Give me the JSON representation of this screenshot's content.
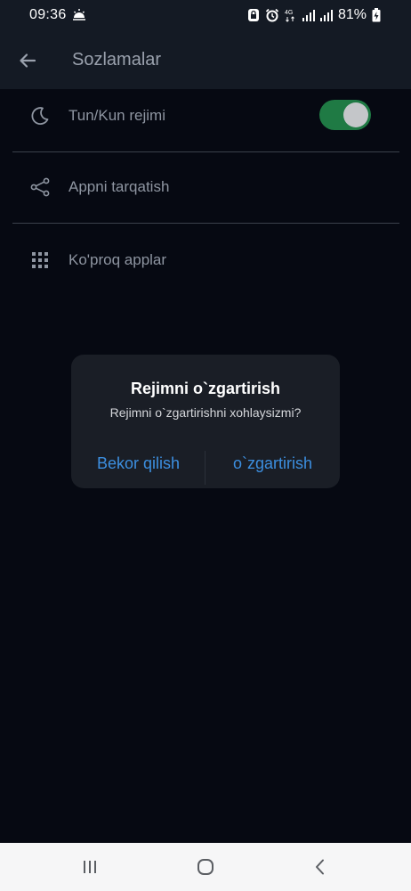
{
  "status_bar": {
    "time": "09:36",
    "network": "4G",
    "battery": "81%"
  },
  "header": {
    "title": "Sozlamalar",
    "back_icon": "arrow-left-icon"
  },
  "settings": {
    "items": [
      {
        "label": "Tun/Kun rejimi",
        "icon": "moon-icon",
        "toggle_on": true
      },
      {
        "label": "Appni tarqatish",
        "icon": "share-icon"
      },
      {
        "label": "Ko'proq applar",
        "icon": "grid-icon"
      }
    ]
  },
  "dialog": {
    "title": "Rejimni o`zgartirish",
    "message": "Rejimni o`zgartirishni xohlaysizmi?",
    "cancel_label": "Bekor qilish",
    "confirm_label": "o`zgartirish"
  },
  "colors": {
    "background": "#060912",
    "header": "#141a24",
    "toggle_on": "#1f7a44",
    "dialog_button": "#3c8fe0"
  }
}
